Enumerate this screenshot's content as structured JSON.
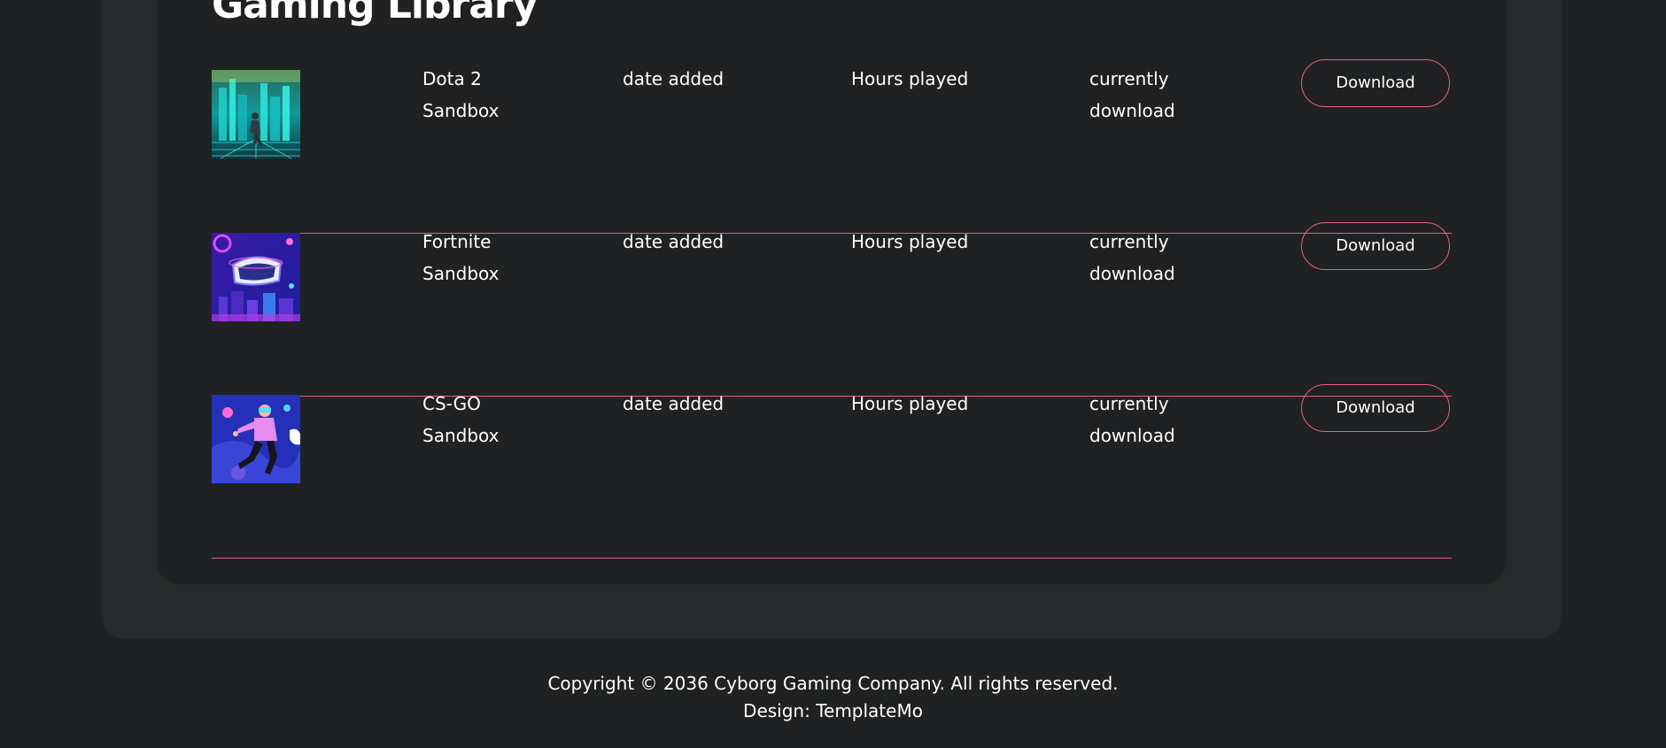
{
  "library": {
    "heading": "Gaming Library",
    "games": [
      {
        "title": "Dota 2",
        "category": "Sandbox",
        "date_label": "date added",
        "hours_label": "Hours played",
        "status_line1": "currently",
        "status_line2": "download",
        "button_label": "Download",
        "thumb": "neon-city-dancer-image"
      },
      {
        "title": "Fortnite",
        "category": "Sandbox",
        "date_label": "date added",
        "hours_label": "Hours played",
        "status_line1": "currently",
        "status_line2": "download",
        "button_label": "Download",
        "thumb": "vr-headset-image"
      },
      {
        "title": "CS-GO",
        "category": "Sandbox",
        "date_label": "date added",
        "hours_label": "Hours played",
        "status_line1": "currently",
        "status_line2": "download",
        "button_label": "Download",
        "thumb": "floating-vr-person-image"
      }
    ]
  },
  "footer": {
    "copyright": "Copyright © 2036 Cyborg Gaming Company. All rights reserved.",
    "design": "Design: TemplateMo"
  },
  "colors": {
    "page_bg": "#1f2122",
    "panel_bg": "#27292a",
    "accent": "#e75e8d",
    "text": "#ffffff"
  }
}
